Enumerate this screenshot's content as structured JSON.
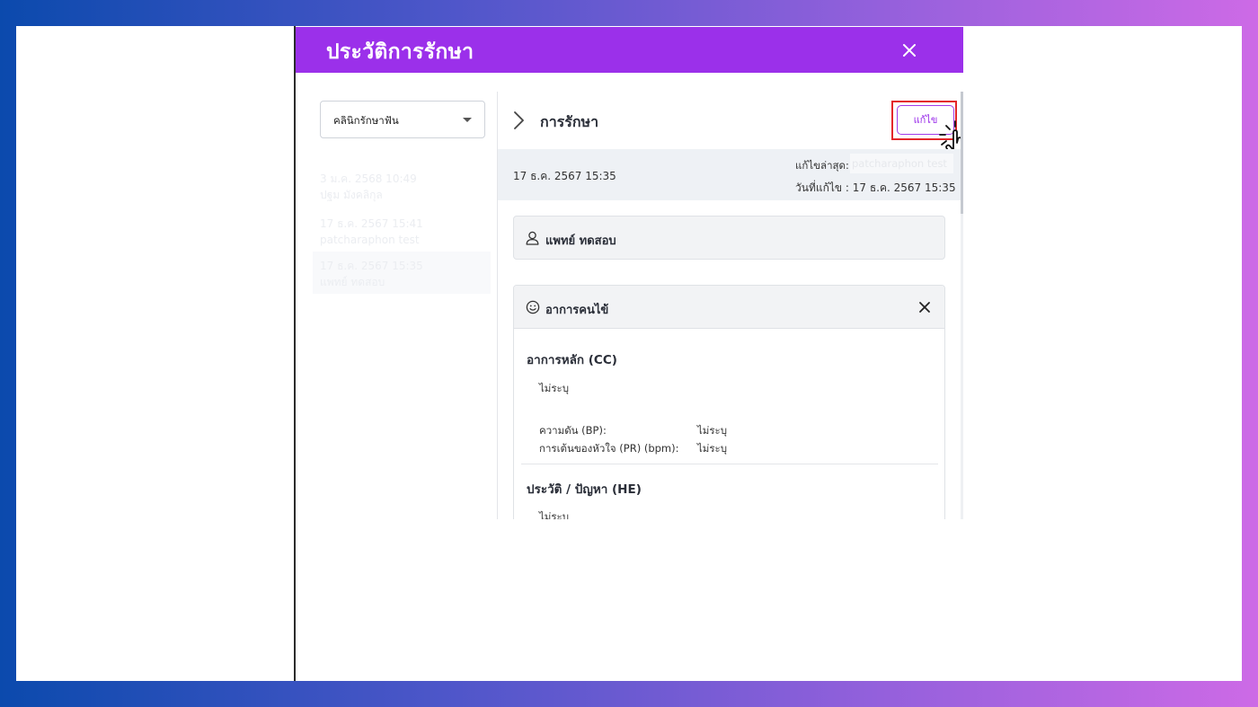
{
  "modal": {
    "title": "ประวัติการรักษา"
  },
  "sidebar": {
    "clinic_select": "คลินิกรักษาฟัน",
    "history": [
      {
        "date": "3 ม.ค. 2568 10:49",
        "name": "ปฐม มังคลิกุล"
      },
      {
        "date": "17 ธ.ค. 2567 15:41",
        "name": "patcharaphon test"
      },
      {
        "date": "17 ธ.ค. 2567 15:35",
        "name": "แพทย์ ทดสอบ"
      }
    ]
  },
  "detail": {
    "title": "การรักษา",
    "edit_button": "แก้ไข",
    "record_date": "17 ธ.ค. 2567 15:35",
    "last_edit_label": "แก้ไขล่าสุด:",
    "last_edit_user": "patcharaphon test",
    "edit_date": "วันที่แก้ไข : 17 ธ.ค. 2567 15:35",
    "doctor": "แพทย์ ทดสอบ",
    "symptoms": {
      "title": "อาการคนไข้",
      "cc_title": "อาการหลัก (CC)",
      "cc_value": "ไม่ระบุ",
      "bp_label": "ความดัน (BP):",
      "bp_value": "ไม่ระบุ",
      "pr_label": "การเต้นของหัวใจ (PR) (bpm):",
      "pr_value": "ไม่ระบุ",
      "he_title": "ประวัติ / ปัญหา (HE)",
      "he_value": "ไม่ระบุ"
    }
  },
  "colors": {
    "header": "#9b30ea",
    "highlight": "#e3262b"
  }
}
